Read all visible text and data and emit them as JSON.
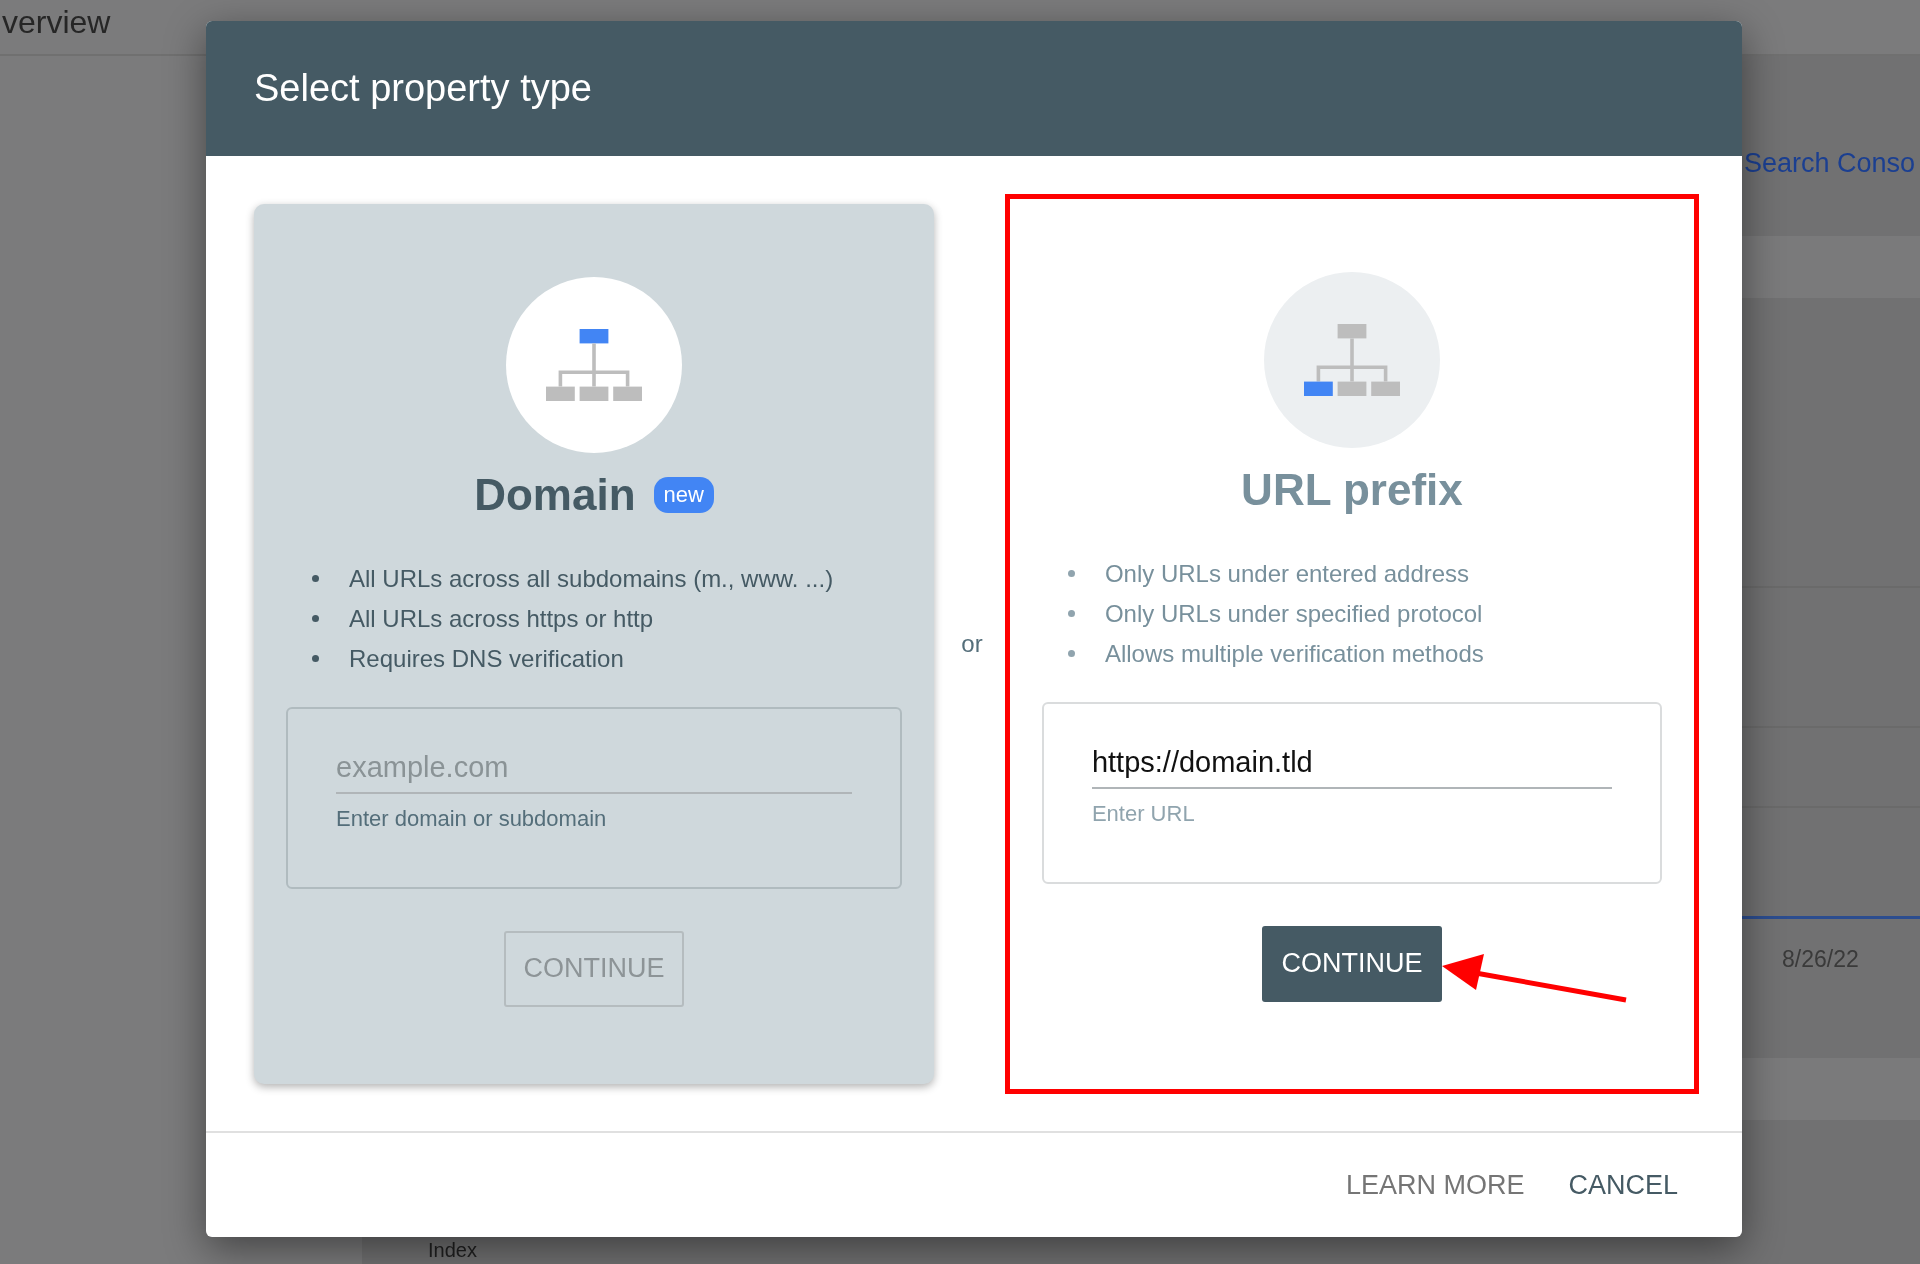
{
  "background": {
    "page_title": "verview",
    "link": "Search Conso",
    "date": "8/26/22",
    "section_title": "Index"
  },
  "dialog": {
    "title": "Select property type",
    "options": [
      {
        "kind": "domain",
        "title": "Domain",
        "badge": "new",
        "raised": true,
        "annotated": false,
        "bullets": [
          "All URLs across all subdomains (m., www. ...)",
          "All URLs across https or http",
          "Requires DNS verification"
        ],
        "field": {
          "placeholder": "example.com",
          "helper": "Enter domain or subdomain"
        },
        "button": {
          "label": "CONTINUE",
          "disabled": true
        }
      },
      {
        "kind": "url_prefix",
        "title": "URL prefix",
        "raised": false,
        "annotated": true,
        "bullets": [
          "Only URLs under entered address",
          "Only URLs under specified protocol",
          "Allows multiple verification methods"
        ],
        "field": {
          "value": "https://domain.tld",
          "helper": "Enter URL"
        },
        "button": {
          "label": "CONTINUE",
          "disabled": false
        }
      }
    ],
    "separator": "or",
    "actions": [
      "LEARN MORE",
      "CANCEL"
    ]
  }
}
